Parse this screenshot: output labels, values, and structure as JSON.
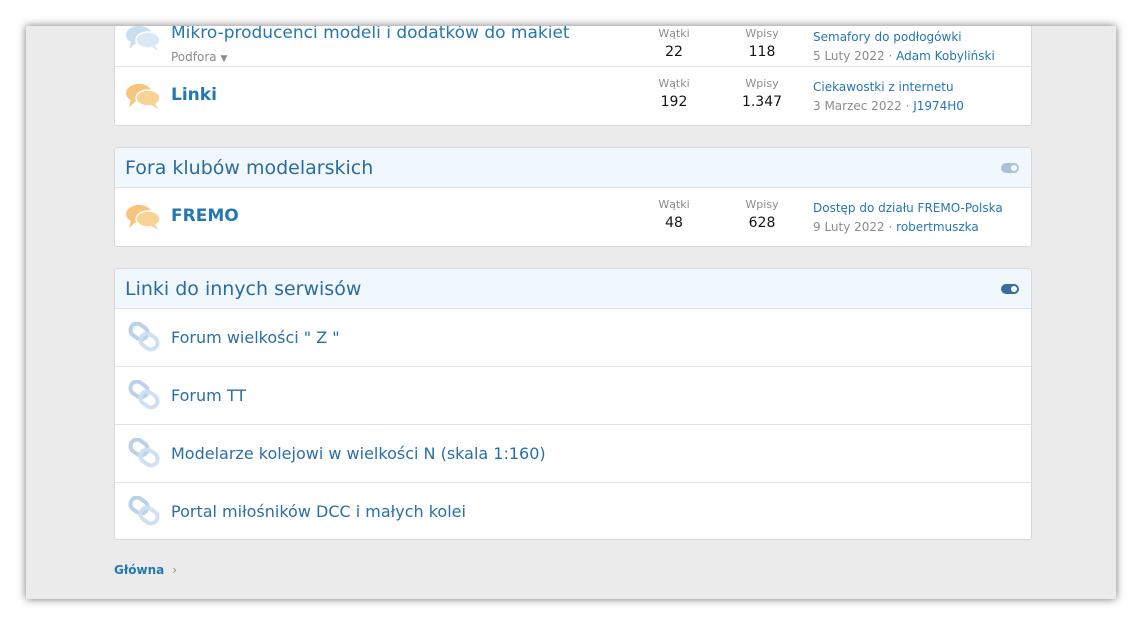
{
  "category_main": {
    "forums": [
      {
        "title": "Mikro-producenci modeli i dodatków do makiet",
        "subforums_label": "Podfora",
        "threads_label": "Wątki",
        "threads": "22",
        "posts_label": "Wpisy",
        "posts": "118",
        "last_title": "Semafory do podłogówki",
        "last_date": "5 Luty 2022",
        "last_user": "Adam Kobyliński",
        "icon": "chat-bubbles-icon-read"
      },
      {
        "title": "Linki",
        "threads_label": "Wątki",
        "threads": "192",
        "posts_label": "Wpisy",
        "posts": "1.347",
        "last_title": "Ciekawostki z internetu",
        "last_date": "3 Marzec 2022",
        "last_user": "J1974H0",
        "icon": "chat-bubbles-icon-unread"
      }
    ]
  },
  "category_clubs": {
    "title": "Fora klubów modelarskich",
    "forums": [
      {
        "title": "FREMO",
        "threads_label": "Wątki",
        "threads": "48",
        "posts_label": "Wpisy",
        "posts": "628",
        "last_title": "Dostęp do działu FREMO-Polska",
        "last_date": "9 Luty 2022",
        "last_user": "robertmuszka",
        "icon": "chat-bubbles-icon-unread"
      }
    ]
  },
  "category_links": {
    "title": "Linki do innych serwisów",
    "links": [
      {
        "title": "Forum wielkości \" Z \"",
        "icon": "link-chain-icon"
      },
      {
        "title": "Forum TT",
        "icon": "link-chain-icon"
      },
      {
        "title": "Modelarze kolejowi w wielkości N (skala 1:160)",
        "icon": "link-chain-icon"
      },
      {
        "title": "Portal miłośników DCC i małych kolei",
        "icon": "link-chain-icon"
      }
    ]
  },
  "breadcrumb": {
    "home": "Główna",
    "separator": "›"
  },
  "colors": {
    "accent": "#2577b1",
    "header_bg": "#f0f7fd",
    "unread_icon": "#f6c47a",
    "read_icon": "#c8def2"
  }
}
